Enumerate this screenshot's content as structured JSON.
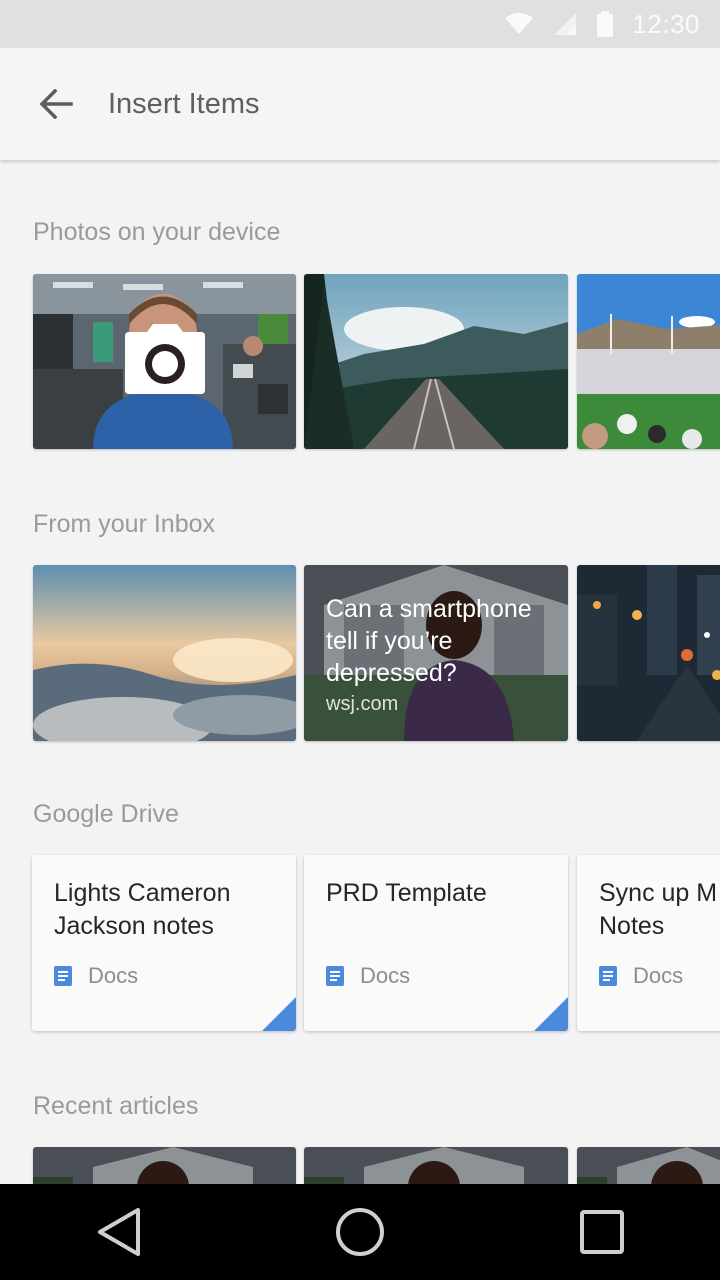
{
  "status_bar": {
    "time": "12:30",
    "icons": [
      "wifi-icon",
      "cell-signal-icon",
      "battery-icon"
    ]
  },
  "app_bar": {
    "title": "Insert Items",
    "back_icon": "arrow-back-icon"
  },
  "sections": {
    "photos": {
      "title": "Photos on your device",
      "camera_icon": "camera-icon"
    },
    "inbox": {
      "title": "From your Inbox",
      "article": {
        "title": "Can a smartphone tell if you’re depressed?",
        "source": "wsj.com"
      }
    },
    "drive": {
      "title": "Google Drive",
      "items": [
        {
          "title": "Lights Cameron Jackson notes",
          "type": "Docs"
        },
        {
          "title": "PRD Template",
          "type": "Docs"
        },
        {
          "title": "Sync up M Notes",
          "type": "Docs"
        }
      ]
    },
    "recent_articles": {
      "title": "Recent articles"
    }
  },
  "colors": {
    "docs_blue": "#4a89dc",
    "app_bar": "#f5f5f5",
    "background": "#f3f3f3"
  },
  "nav_bar": {
    "icons": [
      "back-triangle-icon",
      "home-circle-icon",
      "recents-square-icon"
    ]
  }
}
